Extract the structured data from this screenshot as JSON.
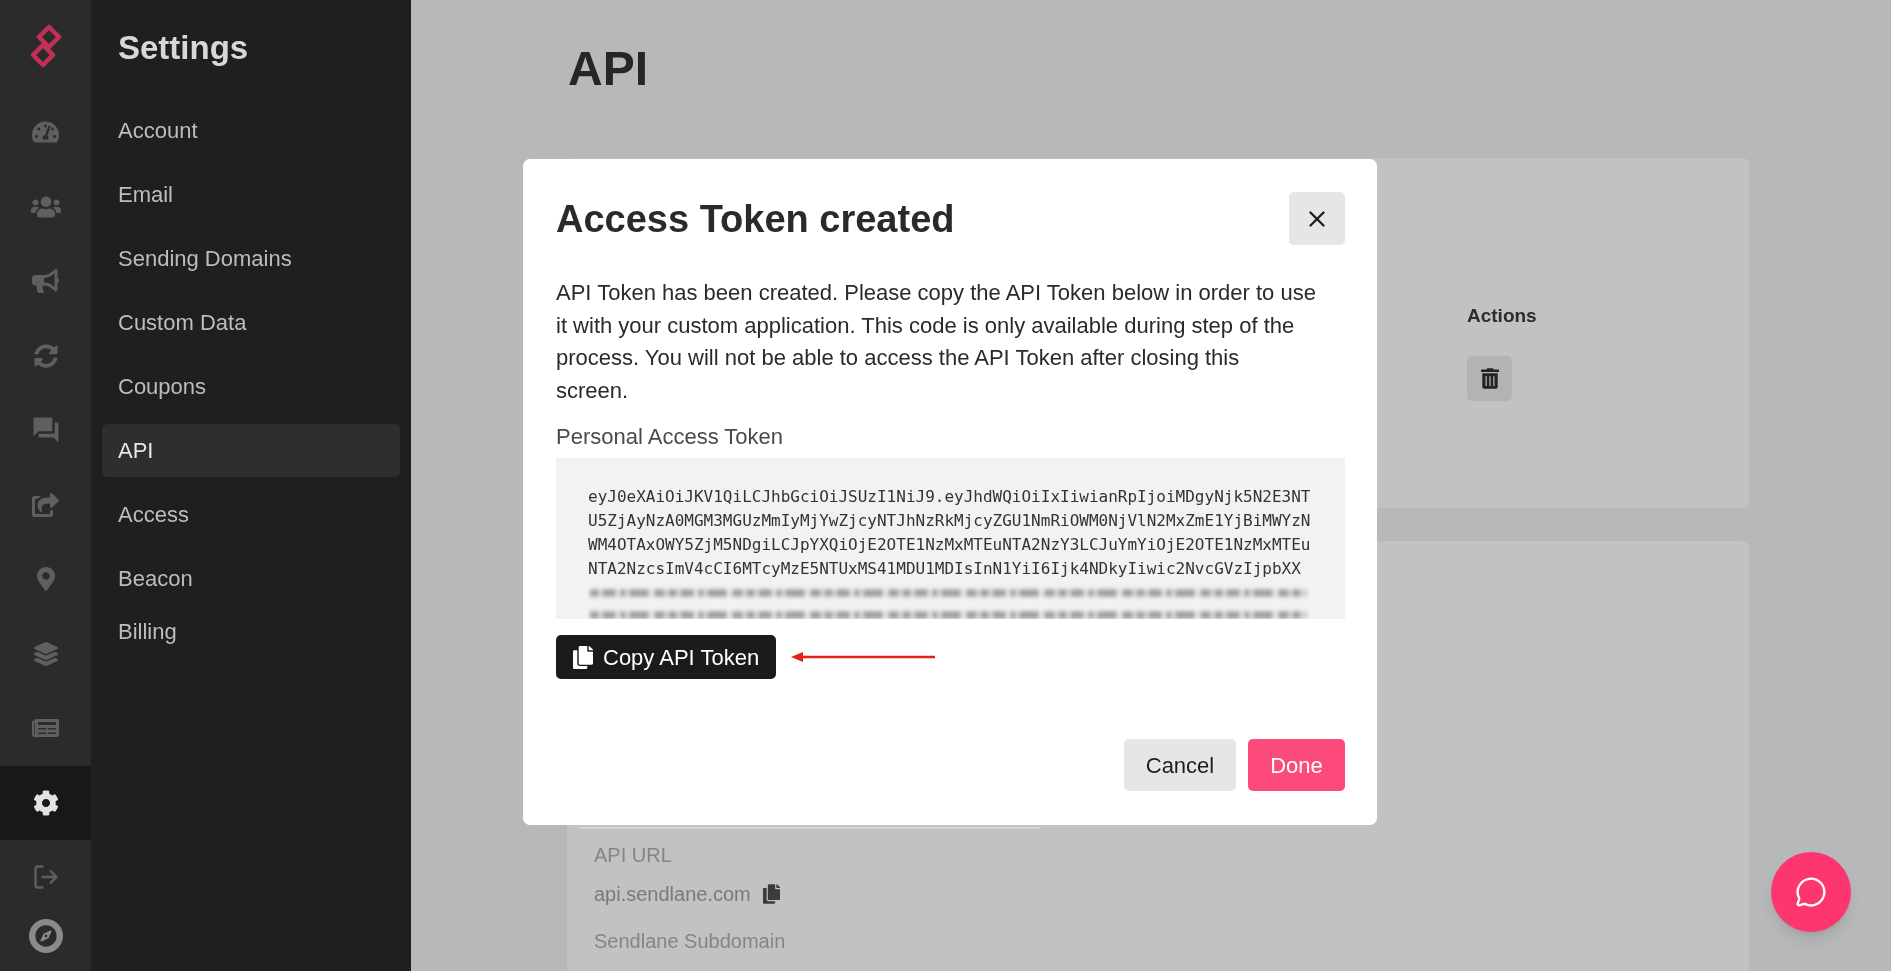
{
  "icon_rail": [
    {
      "selected": false
    },
    {
      "selected": false
    },
    {
      "selected": false
    },
    {
      "selected": false
    },
    {
      "selected": false
    },
    {
      "selected": false
    },
    {
      "selected": false
    },
    {
      "selected": false
    },
    {
      "selected": false
    },
    {
      "selected": true
    },
    {
      "selected": false
    }
  ],
  "sidebar": {
    "title": "Settings",
    "items": [
      {
        "label": "Account",
        "selected": false
      },
      {
        "label": "Email",
        "selected": false
      },
      {
        "label": "Sending Domains",
        "selected": false
      },
      {
        "label": "Custom Data",
        "selected": false
      },
      {
        "label": "Coupons",
        "selected": false
      },
      {
        "label": "API",
        "selected": true
      },
      {
        "label": "Access",
        "selected": false
      },
      {
        "label": "Beacon",
        "selected": false
      },
      {
        "label": "Billing",
        "selected": false
      }
    ]
  },
  "page": {
    "title": "API",
    "tokens_card": {
      "actions_header": "Actions"
    },
    "details_card": {
      "fields": [
        {
          "label": "API URL",
          "value": "api.sendlane.com"
        },
        {
          "label": "Sendlane Subdomain"
        }
      ]
    }
  },
  "dialog": {
    "title": "Access Token created",
    "message": "API Token has been created. Please copy the API Token below in order to use it with your custom application. This code is only available during step of the process. You will not be able to access the API Token after closing this screen.",
    "token_label": "Personal Access Token",
    "token_lines": [
      "eyJ0eXAiOiJKV1QiLCJhbGciOiJSUzI1NiJ9.eyJhdWQiOiIxIiwianRpIjoiMDgyNjk5N2E3NT",
      "U5ZjAyNzA0MGM3MGUzMmIyMjYwZjcyNTJhNzRkMjcyZGU1NmRiOWM0NjVlN2MxZmE1YjBiMWYzN",
      "WM4OTAxOWY5ZjM5NDgiLCJpYXQiOjE2OTE1NzMxMTEuNTA2NzY3LCJuYmYiOjE2OTE1NzMxMTEu",
      "NTA2NzcsImV4cCI6MTcyMzE5NTUxMS41MDU1MDIsInN1YiI6Ijk4NDkyIiwic2NvcGVzIjpbXX"
    ],
    "copy_button": "Copy API Token",
    "buttons": [
      {
        "label": "Cancel",
        "kind": "secondary"
      },
      {
        "label": "Done",
        "kind": "primary"
      }
    ]
  }
}
